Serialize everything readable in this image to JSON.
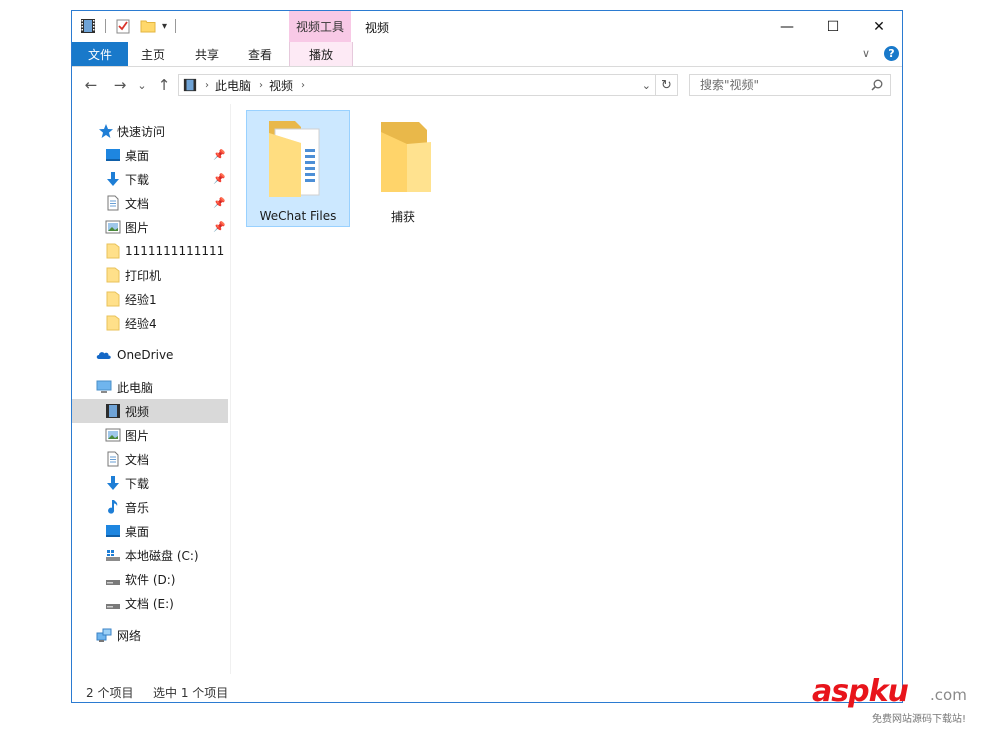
{
  "window": {
    "title": "视频",
    "contextual_tab_group": "视频工具",
    "controls": {
      "minimize": "—",
      "maximize": "☐",
      "close": "✕"
    }
  },
  "ribbon": {
    "tabs": [
      {
        "label": "文件"
      },
      {
        "label": "主页"
      },
      {
        "label": "共享"
      },
      {
        "label": "查看"
      },
      {
        "label": "播放"
      }
    ],
    "chevron": "∨",
    "help": "?"
  },
  "navigation": {
    "back": "←",
    "forward": "→",
    "recent": "⌄",
    "up": "↑",
    "breadcrumb": [
      "此电脑",
      "视频"
    ],
    "refresh": "↻"
  },
  "search": {
    "placeholder": "搜索\"视频\""
  },
  "sidebar": {
    "quick_access": {
      "label": "快速访问",
      "items": [
        {
          "label": "桌面",
          "icon": "desktop-icon",
          "pinned": true
        },
        {
          "label": "下载",
          "icon": "download-icon",
          "pinned": true
        },
        {
          "label": "文档",
          "icon": "document-icon",
          "pinned": true
        },
        {
          "label": "图片",
          "icon": "pictures-icon",
          "pinned": true
        },
        {
          "label": "1111111111111",
          "icon": "folder-icon",
          "pinned": false
        },
        {
          "label": "打印机",
          "icon": "folder-icon",
          "pinned": false
        },
        {
          "label": "经验1",
          "icon": "folder-icon",
          "pinned": false
        },
        {
          "label": "经验4",
          "icon": "folder-icon",
          "pinned": false
        }
      ]
    },
    "onedrive": {
      "label": "OneDrive"
    },
    "this_pc": {
      "label": "此电脑",
      "items": [
        {
          "label": "视频",
          "icon": "videos-icon",
          "selected": true
        },
        {
          "label": "图片",
          "icon": "pictures-icon",
          "selected": false
        },
        {
          "label": "文档",
          "icon": "document-icon",
          "selected": false
        },
        {
          "label": "下载",
          "icon": "download-icon",
          "selected": false
        },
        {
          "label": "音乐",
          "icon": "music-icon",
          "selected": false
        },
        {
          "label": "桌面",
          "icon": "desktop-icon",
          "selected": false
        },
        {
          "label": "本地磁盘 (C:)",
          "icon": "system-drive-icon",
          "selected": false
        },
        {
          "label": "软件 (D:)",
          "icon": "drive-icon",
          "selected": false
        },
        {
          "label": "文档 (E:)",
          "icon": "drive-icon",
          "selected": false
        }
      ]
    },
    "network": {
      "label": "网络"
    }
  },
  "content": {
    "items": [
      {
        "label": "WeChat Files",
        "selected": true
      },
      {
        "label": "捕获",
        "selected": false
      }
    ]
  },
  "status": {
    "item_count": "2 个项目",
    "selection": "选中 1 个项目"
  },
  "watermark": {
    "brand": "aspku",
    "tld": ".com",
    "tagline": "免费网站源码下载站!"
  },
  "colors": {
    "accent": "#1979ca",
    "contextual_tab": "#f8c9e6",
    "selection": "#cce8ff",
    "watermark_red": "#e8141b"
  }
}
